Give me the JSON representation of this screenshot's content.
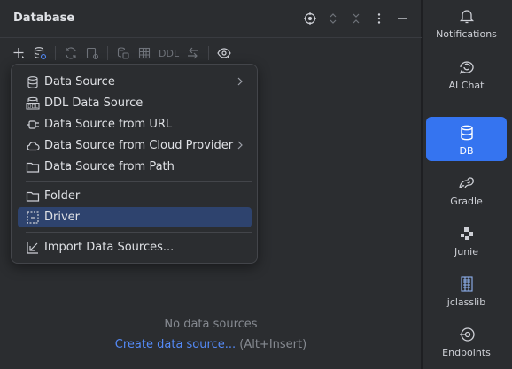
{
  "panel": {
    "title": "Database",
    "toolbar": {
      "ddl_label": "DDL"
    },
    "empty_text": "No data sources",
    "create_link": "Create data source...",
    "create_shortcut": "(Alt+Insert)"
  },
  "menu": {
    "items": [
      {
        "label": "Data Source",
        "icon": "database-icon",
        "submenu": true
      },
      {
        "label": "DDL Data Source",
        "icon": "ddl-icon",
        "submenu": false
      },
      {
        "label": "Data Source from URL",
        "icon": "plug-icon",
        "submenu": false
      },
      {
        "label": "Data Source from Cloud Provider",
        "icon": "cloud-icon",
        "submenu": true
      },
      {
        "label": "Data Source from Path",
        "icon": "folder-icon",
        "submenu": false
      },
      {
        "label": "Folder",
        "icon": "folder-icon",
        "submenu": false
      },
      {
        "label": "Driver",
        "icon": "driver-icon",
        "submenu": false,
        "selected": true
      },
      {
        "label": "Import Data Sources...",
        "icon": "import-icon",
        "submenu": false
      }
    ]
  },
  "strip": {
    "items": [
      {
        "label": "Notifications",
        "icon": "bell-icon"
      },
      {
        "label": "AI Chat",
        "icon": "ai-chat-icon"
      },
      {
        "label": "DB",
        "icon": "database-icon",
        "active": true
      },
      {
        "label": "Gradle",
        "icon": "gradle-icon"
      },
      {
        "label": "Junie",
        "icon": "junie-icon"
      },
      {
        "label": "jclasslib",
        "icon": "jclasslib-icon"
      },
      {
        "label": "Endpoints",
        "icon": "endpoints-icon"
      }
    ]
  },
  "colors": {
    "background": "#2b2d30",
    "accent": "#3574f0",
    "selection": "#2e436e",
    "link": "#548af7"
  }
}
